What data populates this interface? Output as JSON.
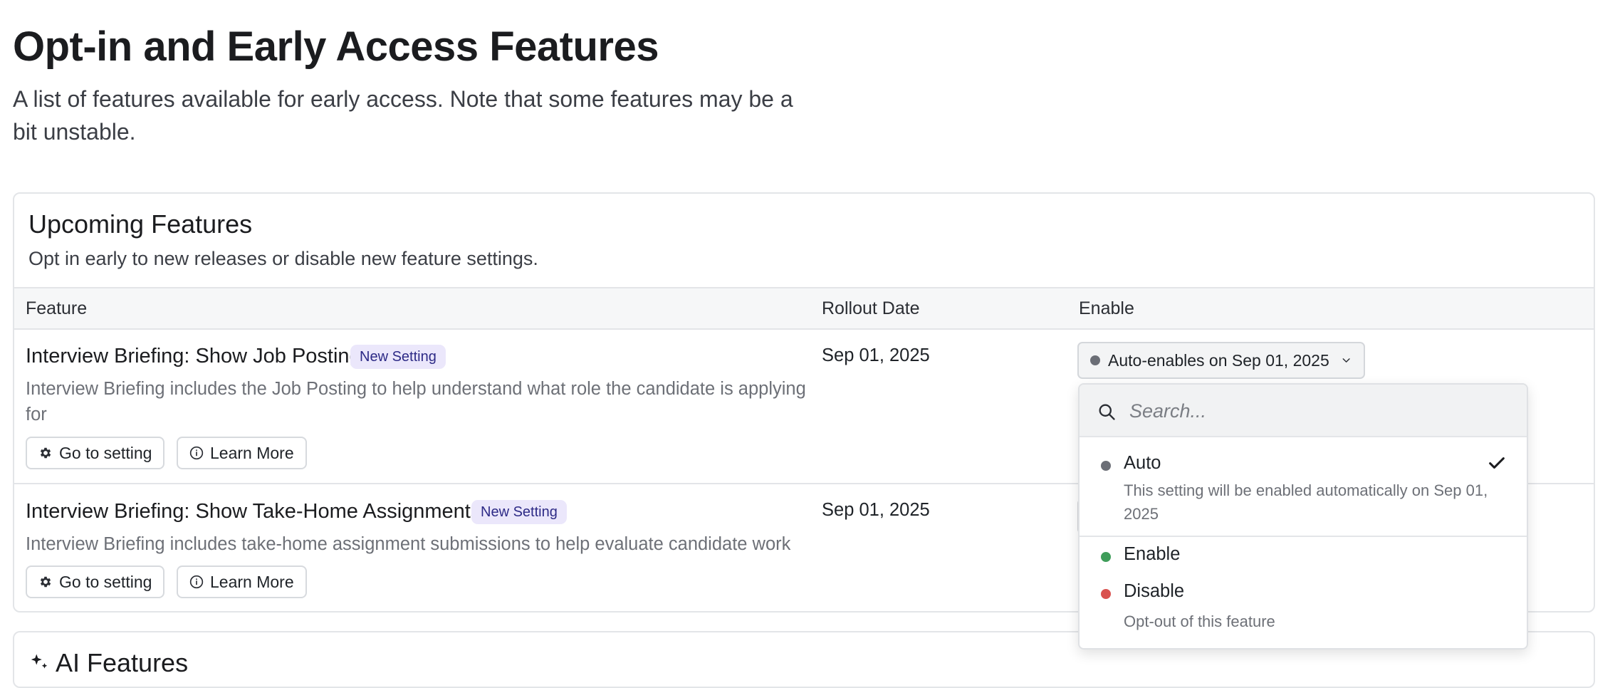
{
  "page": {
    "title": "Opt-in and Early Access Features",
    "subtitle": "A list of features available for early access. Note that some features may be a bit unstable."
  },
  "upcoming": {
    "title": "Upcoming Features",
    "description": "Opt in early to new releases or disable new feature settings.",
    "columns": {
      "feature": "Feature",
      "rollout": "Rollout Date",
      "enable": "Enable"
    },
    "rows": [
      {
        "name": "Interview Briefing: Show Job Posting",
        "badge": "New Setting",
        "description": "Interview Briefing includes the Job Posting to help understand what role the candidate is applying for",
        "rollout_date": "Sep 01, 2025",
        "enable_value": "Auto-enables on Sep 01, 2025",
        "go_to_setting": "Go to setting",
        "learn_more": "Learn More"
      },
      {
        "name": "Interview Briefing: Show Take-Home Assignments",
        "badge": "New Setting",
        "description": "Interview Briefing includes take-home assignment submissions to help evaluate candidate work",
        "rollout_date": "Sep 01, 2025",
        "go_to_setting": "Go to setting",
        "learn_more": "Learn More"
      }
    ]
  },
  "dropdown": {
    "search_placeholder": "Search...",
    "options": [
      {
        "label": "Auto",
        "description": "This setting will be enabled automatically on Sep 01, 2025",
        "color": "#6b6e76",
        "selected": true
      },
      {
        "label": "Enable",
        "description": "",
        "color": "#3f9d5a",
        "selected": false
      },
      {
        "label": "Disable",
        "description": "Opt-out of this feature",
        "color": "#d9514e",
        "selected": false
      }
    ]
  },
  "ai_features": {
    "title": "AI Features"
  },
  "colors": {
    "badge_bg": "#ebe7fb",
    "badge_text": "#2d2a86",
    "auto_dot": "#6b6e76",
    "enable_dot": "#3f9d5a",
    "disable_dot": "#d9514e"
  }
}
